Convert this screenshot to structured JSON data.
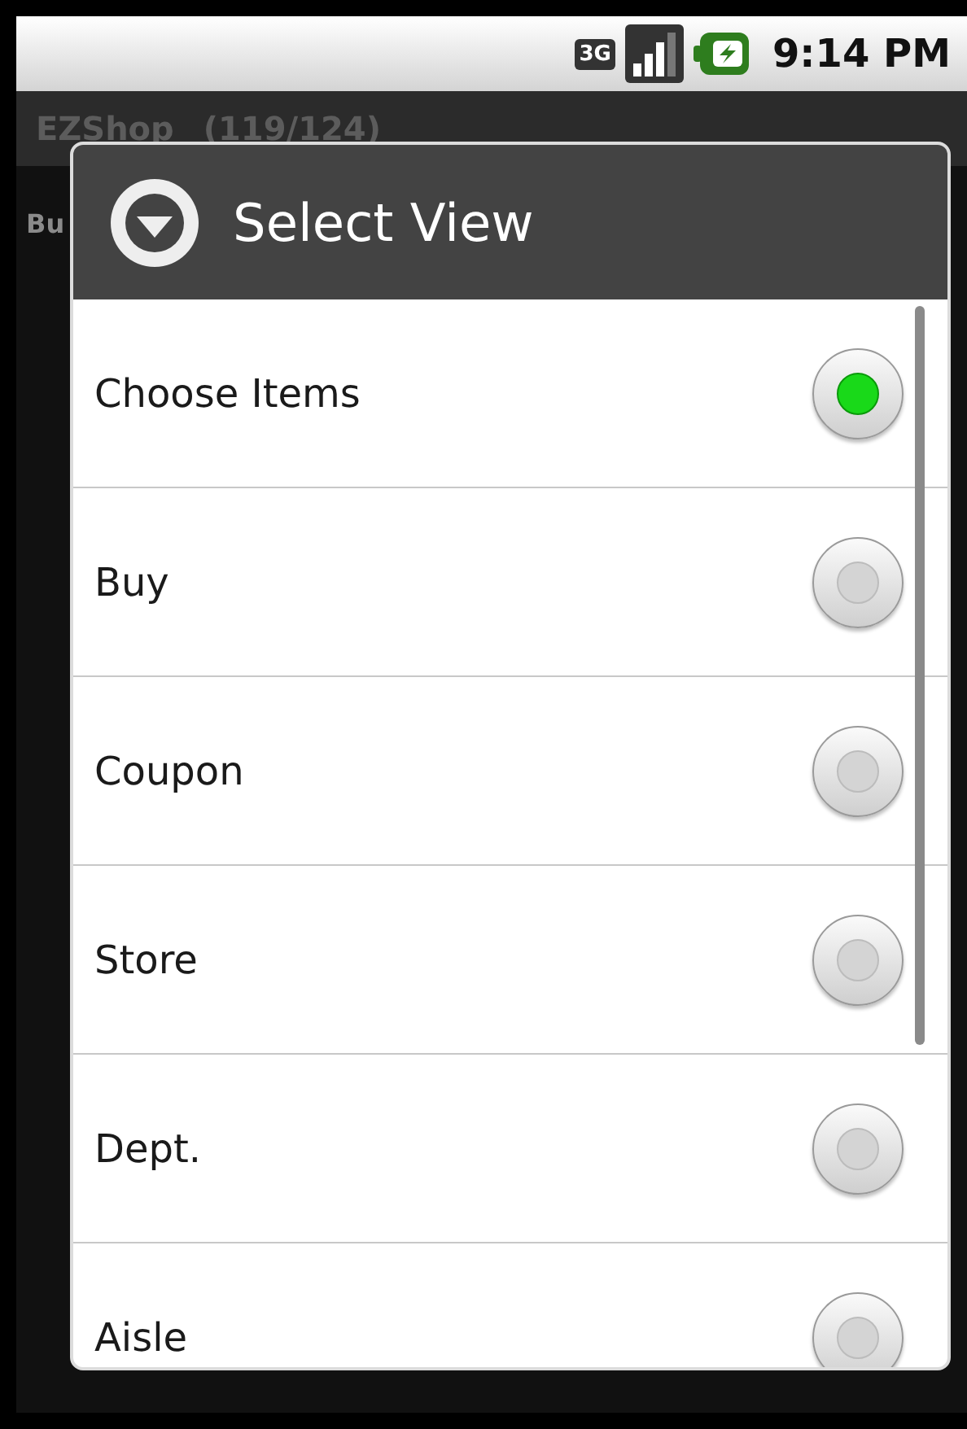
{
  "status_bar": {
    "network": "3G",
    "time": "9:14 PM"
  },
  "app": {
    "title": "EZShop",
    "count": "(119/124)",
    "section": "Bu"
  },
  "dialog": {
    "title": "Select View",
    "options": [
      {
        "label": "Choose Items",
        "selected": true
      },
      {
        "label": "Buy",
        "selected": false
      },
      {
        "label": "Coupon",
        "selected": false
      },
      {
        "label": "Store",
        "selected": false
      },
      {
        "label": "Dept.",
        "selected": false
      },
      {
        "label": "Aisle",
        "selected": false
      }
    ]
  }
}
